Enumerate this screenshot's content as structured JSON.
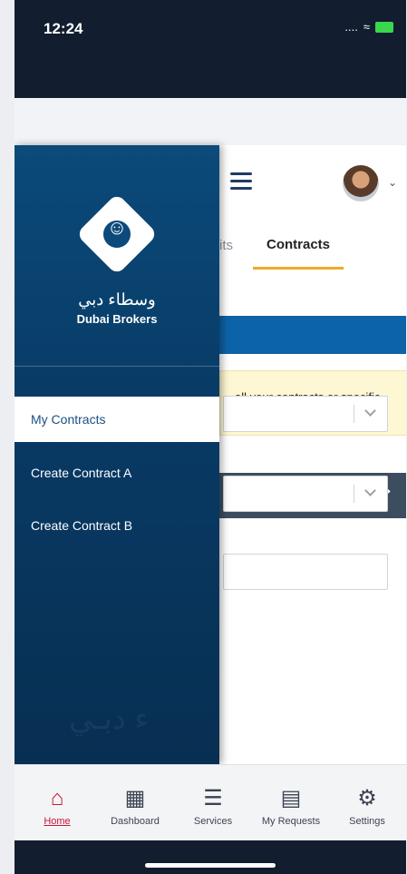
{
  "status_bar": {
    "time": "12:24",
    "signal": "....",
    "wifi_icon": "wifi-icon",
    "battery_icon": "battery-icon"
  },
  "header": {
    "menu_icon": "hamburger-icon",
    "avatar": "user-avatar",
    "avatar_chevron": "chevron-down-icon"
  },
  "tabs": {
    "previous_partial": "its",
    "active": "Contracts"
  },
  "info": {
    "text": "all your contracts or specific contracts."
  },
  "drawer": {
    "logo_arabic": "وسطاء دبي",
    "logo_english": "Dubai Brokers",
    "items": [
      {
        "label": "My Contracts",
        "active": true
      },
      {
        "label": "Create Contract A",
        "active": false
      },
      {
        "label": "Create Contract B",
        "active": false
      }
    ],
    "watermark": "ء دبـي"
  },
  "bottom_nav": [
    {
      "label": "Home",
      "icon": "home-icon",
      "active": true
    },
    {
      "label": "Dashboard",
      "icon": "dashboard-icon",
      "active": false
    },
    {
      "label": "Services",
      "icon": "services-icon",
      "active": false
    },
    {
      "label": "My Requests",
      "icon": "requests-icon",
      "active": false
    },
    {
      "label": "Settings",
      "icon": "settings-icon",
      "active": false
    }
  ],
  "colors": {
    "drawer": "#0b4a7a",
    "accent": "#f0a92a",
    "active_nav": "#c7163b",
    "statusbar": "#131d30",
    "blue_band": "#0d63a7"
  }
}
